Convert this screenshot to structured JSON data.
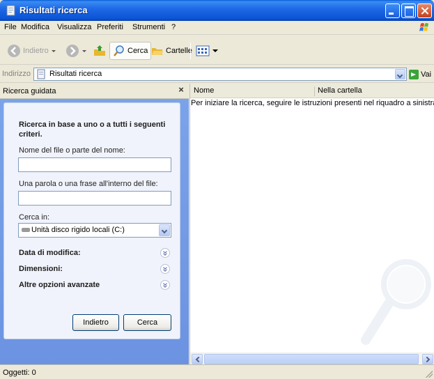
{
  "window": {
    "title": "Risultati ricerca"
  },
  "menu": {
    "items": [
      "File",
      "Modifica",
      "Visualizza",
      "Preferiti",
      "Strumenti",
      "?"
    ]
  },
  "toolbar": {
    "back_label": "Indietro",
    "search_label": "Cerca",
    "folders_label": "Cartelle"
  },
  "address": {
    "label": "Indirizzo",
    "value": "Risultati ricerca",
    "go_label": "Vai"
  },
  "search_pane": {
    "title": "Ricerca guidata",
    "close_glyph": "×",
    "heading": "Ricerca in base a uno o a tutti i seguenti criteri.",
    "filename_label": "Nome del file o parte del nome:",
    "filename_value": "",
    "phrase_label": "Una parola o una frase all'interno del file:",
    "phrase_value": "",
    "lookin_label": "Cerca in:",
    "lookin_value": "Unità disco rigido locali (C:)",
    "options": [
      "Data di modifica:",
      "Dimensioni:",
      "Altre opzioni avanzate"
    ],
    "back_button": "Indietro",
    "search_button": "Cerca"
  },
  "results": {
    "columns": [
      "Nome",
      "Nella cartella"
    ],
    "message": "Per iniziare la ricerca, seguire le istruzioni presenti nel riquadro a sinistra"
  },
  "status": {
    "text": "Oggetti: 0"
  }
}
